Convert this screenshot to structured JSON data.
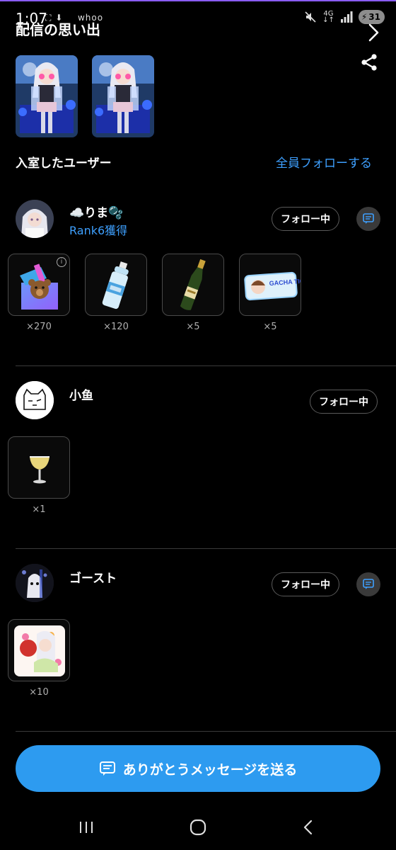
{
  "status": {
    "time": "1:07",
    "left_icons": "⛶ ⬇ ㅤ whoo",
    "network": "4G",
    "battery": "31"
  },
  "header": {
    "title": "配信の思い出"
  },
  "entered_users": {
    "label": "入室したユーザー",
    "follow_all": "全員フォローする"
  },
  "users": [
    {
      "name": "☁️りま🫧",
      "rank": "Rank6獲得",
      "follow_label": "フォロー中",
      "gifts": [
        {
          "icon": "teddy-gift-box-icon",
          "count": "×270"
        },
        {
          "icon": "water-bottle-icon",
          "count": "×120"
        },
        {
          "icon": "champagne-bottle-icon",
          "count": "×5"
        },
        {
          "icon": "gacha-ticket-icon",
          "count": "×5"
        }
      ]
    },
    {
      "name": "小鱼",
      "follow_label": "フォロー中",
      "gifts": [
        {
          "icon": "cocktail-glass-icon",
          "count": "×1"
        }
      ]
    },
    {
      "name": "ゴースト",
      "follow_label": "フォロー中",
      "gifts": [
        {
          "icon": "anime-sticker-icon",
          "count": "×10"
        }
      ]
    }
  ],
  "gacha_ticket_text": "GACHA TICKET",
  "cta": {
    "label": "ありがとうメッセージを送る"
  },
  "colors": {
    "accent": "#3ea0ff",
    "cta": "#2d9bf0",
    "background": "#000000"
  }
}
